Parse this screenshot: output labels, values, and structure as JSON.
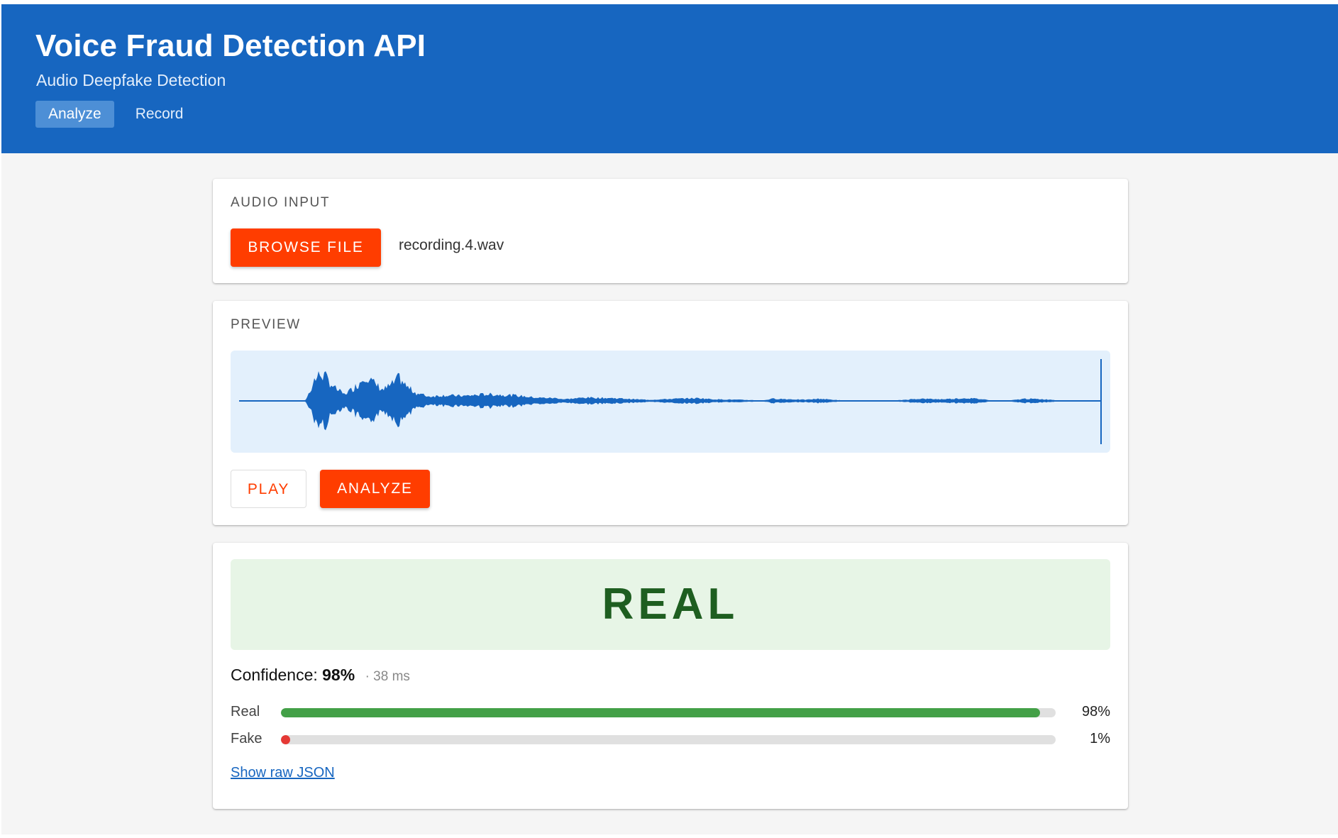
{
  "header": {
    "title": "Voice Fraud Detection API",
    "subtitle": "Audio Deepfake Detection",
    "tabs": [
      {
        "label": "Analyze",
        "active": true
      },
      {
        "label": "Record",
        "active": false
      }
    ]
  },
  "audio_input": {
    "label": "AUDIO INPUT",
    "browse_label": "BROWSE FILE",
    "file_name": "recording.4.wav"
  },
  "preview": {
    "label": "PREVIEW",
    "play_label": "PLAY",
    "analyze_label": "ANALYZE"
  },
  "result": {
    "verdict": "REAL",
    "confidence_label": "Confidence:",
    "confidence_value": "98%",
    "latency": "· 38 ms",
    "scores": [
      {
        "label": "Real",
        "value": 0.98,
        "display": "98%",
        "color": "#43a047"
      },
      {
        "label": "Fake",
        "value": 0.01,
        "display": "1%",
        "color": "#e53935"
      }
    ],
    "raw_json_link": "Show raw JSON"
  },
  "colors": {
    "header": "#1766c0",
    "accent": "#ff3d00",
    "waveform": "#1766c0",
    "verdict_text": "#1e5e20",
    "verdict_bg": "#e7f5e6"
  }
}
